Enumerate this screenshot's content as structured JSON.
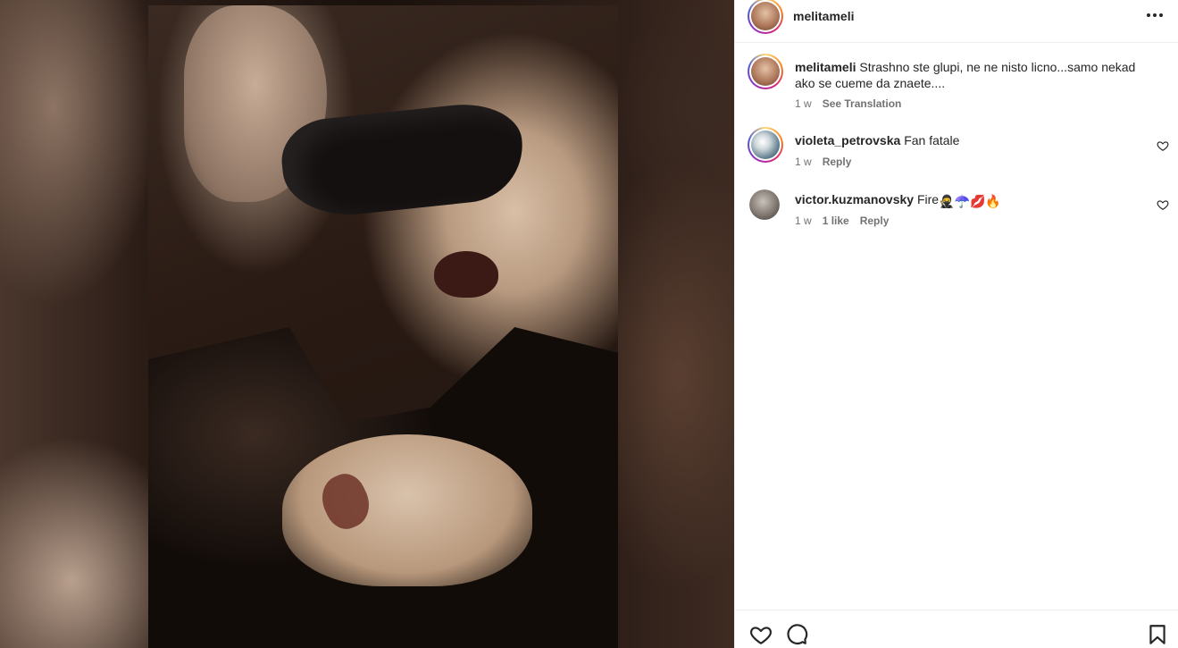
{
  "post": {
    "author": "melitameli",
    "more_icon": "more-horizontal-icon"
  },
  "comments": [
    {
      "username": "melitameli",
      "text": "Strashno ste glupi, ne ne nisto licno...samo nekad ako se cueme da znaete....",
      "time": "1 w",
      "action": "See Translation"
    },
    {
      "username": "violeta_petrovska",
      "text": "Fan fatale",
      "time": "1 w",
      "action": "Reply"
    },
    {
      "username": "victor.kuzmanovsky",
      "text": "Fire",
      "emojis": "🥷☂️💋🔥",
      "time": "1 w",
      "likes": "1 like",
      "action": "Reply"
    }
  ],
  "actions": {
    "like_icon": "heart-icon",
    "comment_icon": "comment-bubble-icon",
    "save_icon": "bookmark-icon"
  },
  "colors": {
    "text": "#262626",
    "secondary": "#737373",
    "divider": "#efefef"
  }
}
